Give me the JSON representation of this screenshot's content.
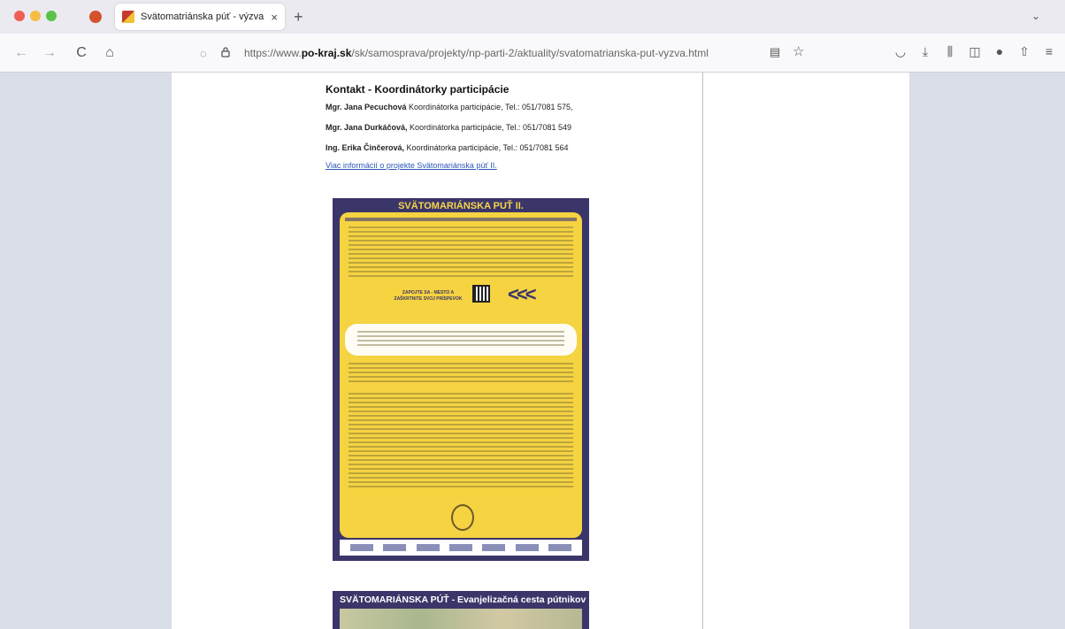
{
  "browser": {
    "tab_title": "Svätomatriánska púť - výzva - P",
    "tab_close": "×",
    "new_tab": "+",
    "url_prefix": "https://www.",
    "url_domain": "po-kraj.sk",
    "url_path": "/sk/samosprava/projekty/np-parti-2/aktuality/svatomatrianska-put-vyzva.html"
  },
  "icons": {
    "back": "←",
    "forward": "→",
    "reload": "C",
    "home": "⌂",
    "shield": "◌",
    "lock": "🔒",
    "reader": "▤",
    "bookmark": "☆",
    "pocket": "◡",
    "download": "⤓",
    "library": "⫼",
    "sidebar": "◫",
    "account": "●",
    "share": "⇧",
    "menu": "≡",
    "tab_list": "⌄"
  },
  "content": {
    "heading": "Kontakt - Koordinátorky participácie",
    "contacts": [
      {
        "name": "Mgr. Jana Pecuchová",
        "text": " Koordinátorka participácie,  Tel.: 051/7081 575,"
      },
      {
        "name": "Mgr. Jana Durkáčová,",
        "text": " Koordinátorka participácie, Tel.: 051/7081 549"
      },
      {
        "name": "Ing. Erika Činčerová,",
        "text": " Koordinátorka participácie, Tel.: 051/7081 564"
      }
    ],
    "more_link": "Viac informácií o projekte Svätomariánska púť II."
  },
  "poster": {
    "title": "SVÄTOMARIÁNSKA PUŤ II.",
    "cta": "ZAPOJTE SA - MESTO A ZAŠKRTNITE SVOJ PRÍSPEVOK"
  },
  "map_card": {
    "title": "SVÄTOMARIÁNSKA PÚŤ - Evanjelizačná cesta pútnikov"
  }
}
